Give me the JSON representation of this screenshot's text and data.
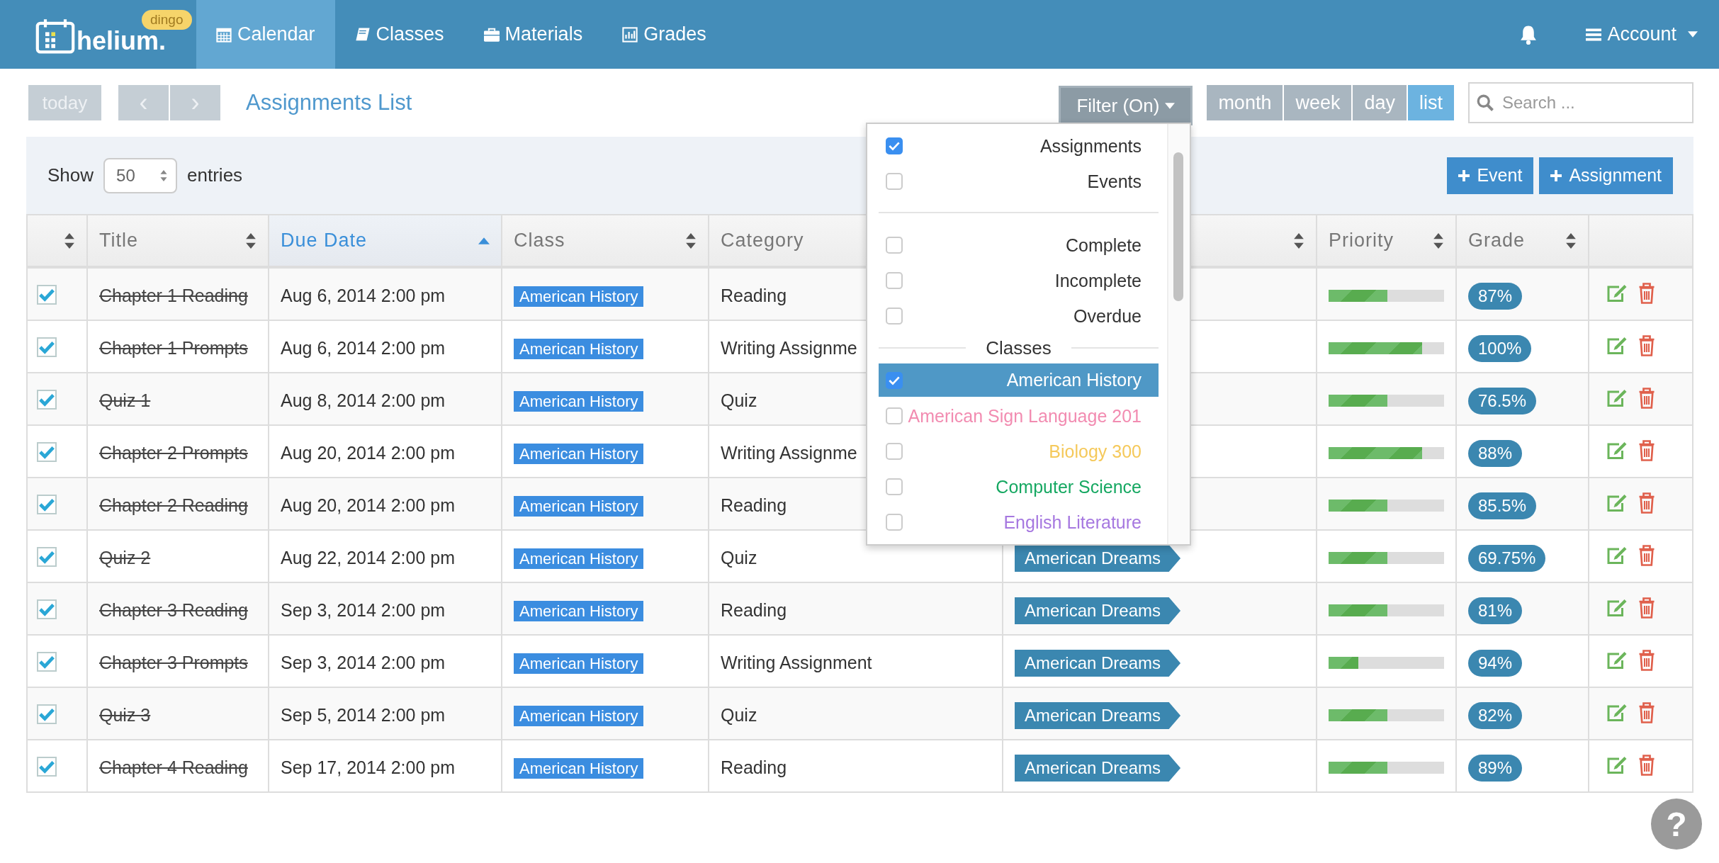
{
  "navbar": {
    "logo_text": "helium.",
    "logo_badge": "dingo",
    "tabs": [
      {
        "label": "Calendar",
        "selected": true
      },
      {
        "label": "Classes",
        "selected": false
      },
      {
        "label": "Materials",
        "selected": false
      },
      {
        "label": "Grades",
        "selected": false
      }
    ],
    "account_label": "Account"
  },
  "toolbar": {
    "today_label": "today",
    "prev_label": "‹",
    "next_label": "›",
    "title": "Assignments List",
    "filter_label": "Filter (On)",
    "views": [
      {
        "label": "month",
        "selected": false
      },
      {
        "label": "week",
        "selected": false
      },
      {
        "label": "day",
        "selected": false
      },
      {
        "label": "list",
        "selected": true
      }
    ],
    "search": {
      "placeholder": "Search ..."
    }
  },
  "list_controls": {
    "show_label": "Show",
    "page_size": "50",
    "entries_label": "entries",
    "buttons": [
      "Event",
      "Assignment"
    ]
  },
  "table": {
    "columns": [
      {
        "sortable": true,
        "sorted": false
      },
      {
        "label": "Title",
        "sortable": true,
        "sorted": false
      },
      {
        "label": "Due Date",
        "sortable": true,
        "sorted": true
      },
      {
        "label": "Class",
        "sortable": true,
        "sorted": false
      },
      {
        "label": "Category"
      },
      {
        "sortable": true,
        "sorted": false
      },
      {
        "label": "Priority",
        "sortable": true,
        "sorted": false
      },
      {
        "label": "Grade",
        "sortable": true,
        "sorted": false
      },
      {}
    ],
    "rows": [
      {
        "completed": true,
        "title": "Chapter 1 Reading",
        "due": "Aug 6, 2014 2:00 pm",
        "class": "American History",
        "category": "Reading",
        "priority": {
          "level": 0.51
        },
        "grade": "87%"
      },
      {
        "completed": true,
        "title": "Chapter 1 Prompts",
        "due": "Aug 6, 2014 2:00 pm",
        "class": "American History",
        "category": "Writing Assignme",
        "priority": {
          "level": 0.81
        },
        "grade": "100%"
      },
      {
        "completed": true,
        "title": "Quiz 1",
        "due": "Aug 8, 2014 2:00 pm",
        "class": "American History",
        "category": "Quiz",
        "priority": {
          "level": 0.51
        },
        "grade": "76.5%"
      },
      {
        "completed": true,
        "title": "Chapter 2 Prompts",
        "due": "Aug 20, 2014 2:00 pm",
        "class": "American History",
        "category": "Writing Assignme",
        "priority": {
          "level": 0.81
        },
        "grade": "88%"
      },
      {
        "completed": true,
        "title": "Chapter 2 Reading",
        "due": "Aug 20, 2014 2:00 pm",
        "class": "American History",
        "category": "Reading",
        "priority": {
          "level": 0.51
        },
        "grade": "85.5%"
      },
      {
        "completed": true,
        "title": "Quiz 2",
        "due": "Aug 22, 2014 2:00 pm",
        "class": "American History",
        "category": "Quiz",
        "column_5": "American Dreams",
        "priority": {
          "level": 0.51
        },
        "grade": "69.75%"
      },
      {
        "completed": true,
        "title": "Chapter 3 Reading",
        "due": "Sep 3, 2014 2:00 pm",
        "class": "American History",
        "category": "Reading",
        "column_5": "American Dreams",
        "priority": {
          "level": 0.51
        },
        "grade": "81%"
      },
      {
        "completed": true,
        "title": "Chapter 3 Prompts",
        "due": "Sep 3, 2014 2:00 pm",
        "class": "American History",
        "category": "Writing Assignment",
        "column_5": "American Dreams",
        "priority": {
          "level": 0.26
        },
        "grade": "94%"
      },
      {
        "completed": true,
        "title": "Quiz 3",
        "due": "Sep 5, 2014 2:00 pm",
        "class": "American History",
        "category": "Quiz",
        "column_5": "American Dreams",
        "priority": {
          "level": 0.51
        },
        "grade": "82%"
      },
      {
        "completed": true,
        "title": "Chapter 4 Reading",
        "due": "Sep 17, 2014 2:00 pm",
        "class": "American History",
        "category": "Reading",
        "column_5": "American Dreams",
        "priority": {
          "level": 0.51
        },
        "grade": "89%"
      }
    ]
  },
  "filter_menu": {
    "types": [
      {
        "label": "Assignments",
        "checked": true
      },
      {
        "label": "Events",
        "checked": false
      }
    ],
    "statuses": [
      {
        "label": "Complete",
        "checked": false
      },
      {
        "label": "Incomplete",
        "checked": false
      },
      {
        "label": "Overdue",
        "checked": false
      }
    ],
    "classes_heading": "Classes",
    "classes": [
      {
        "label": "American History",
        "checked": true,
        "selected": true,
        "color": "#4f98c6"
      },
      {
        "label": "American Sign Language 201",
        "checked": false,
        "selected": false,
        "color": "#f28cb1"
      },
      {
        "label": "Biology 300",
        "checked": false,
        "selected": false,
        "color": "#f5c95b"
      },
      {
        "label": "Computer Science",
        "checked": false,
        "selected": false,
        "color": "#16a862"
      },
      {
        "label": "English Literature",
        "checked": false,
        "selected": false,
        "color": "#a678e0"
      }
    ]
  },
  "help_button": "?"
}
